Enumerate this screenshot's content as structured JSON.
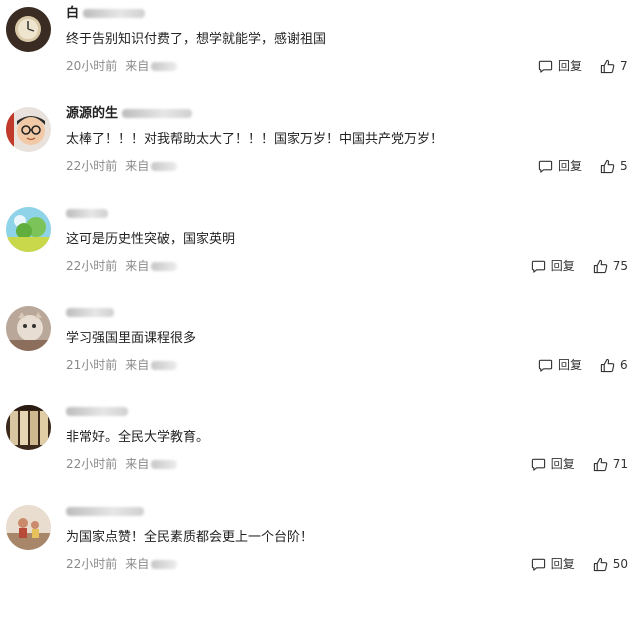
{
  "comments": [
    {
      "username": "白",
      "content": "终于告别知识付费了，想学就能学，感谢祖国",
      "time": "20小时前",
      "location_prefix": "来自",
      "reply_label": "回复",
      "likes": "7"
    },
    {
      "username": "源源的生",
      "content": "太棒了！！！对我帮助太大了！！！国家万岁！中国共产党万岁！",
      "time": "22小时前",
      "location_prefix": "来自",
      "reply_label": "回复",
      "likes": "5"
    },
    {
      "username": "",
      "content": "这可是历史性突破，国家英明",
      "time": "22小时前",
      "location_prefix": "来自",
      "reply_label": "回复",
      "likes": "75"
    },
    {
      "username": "",
      "content": "学习强国里面课程很多",
      "time": "21小时前",
      "location_prefix": "来自",
      "reply_label": "回复",
      "likes": "6"
    },
    {
      "username": "",
      "content": "非常好。全民大学教育。",
      "time": "22小时前",
      "location_prefix": "来自",
      "reply_label": "回复",
      "likes": "71"
    },
    {
      "username": "",
      "content": "为国家点赞！全民素质都会更上一个台阶！",
      "time": "22小时前",
      "location_prefix": "来自",
      "reply_label": "回复",
      "likes": "50"
    }
  ],
  "icons": {
    "reply": "comment-bubble-icon",
    "like": "thumbs-up-icon"
  }
}
